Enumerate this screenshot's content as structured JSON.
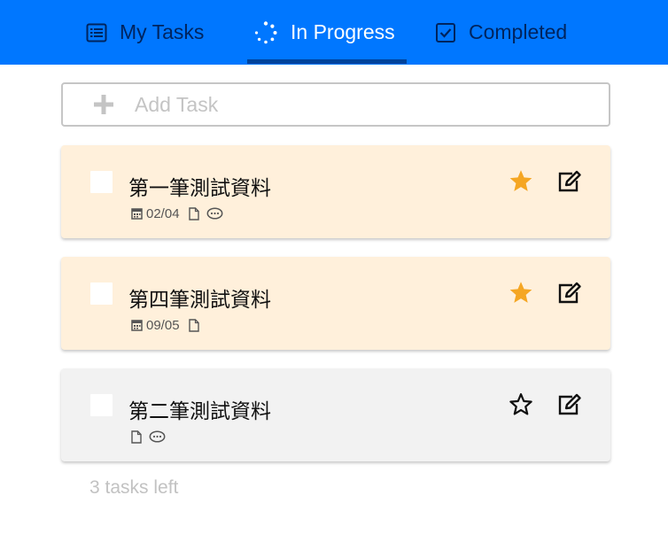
{
  "tabs": [
    {
      "label": "My Tasks",
      "icon": "list-icon",
      "active": false
    },
    {
      "label": "In Progress",
      "icon": "spinner-icon",
      "active": true
    },
    {
      "label": "Completed",
      "icon": "checkbox-icon",
      "active": false
    }
  ],
  "add_task": {
    "placeholder": "Add Task",
    "icon": "plus-icon"
  },
  "tasks": [
    {
      "title": "第一筆測試資料",
      "date": "02/04",
      "starred": true,
      "has_file": true,
      "has_comment": true
    },
    {
      "title": "第四筆測試資料",
      "date": "09/05",
      "starred": true,
      "has_file": true,
      "has_comment": false
    },
    {
      "title": "第二筆測試資料",
      "date": "",
      "starred": false,
      "has_file": true,
      "has_comment": true
    }
  ],
  "footer": {
    "text": "3 tasks left"
  },
  "colors": {
    "header": "#0077ff",
    "active_tab_underline": "#00439c",
    "inactive_tab_text": "#00245e",
    "starred_card_bg": "#fff0db",
    "card_bg": "#f2f2f2",
    "star_active": "#f5a623"
  }
}
